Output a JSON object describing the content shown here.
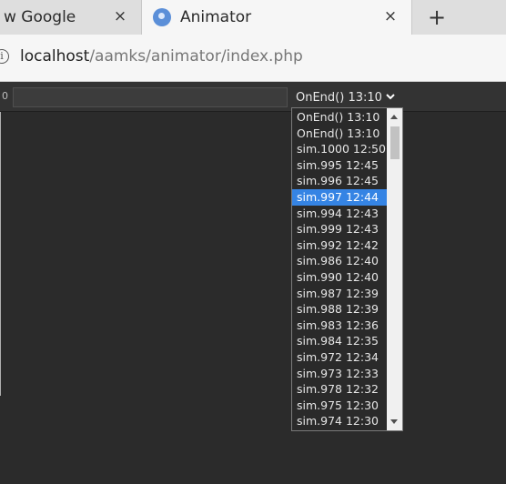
{
  "browser": {
    "tabs": [
      {
        "title": "w Google",
        "close": "×"
      },
      {
        "title": "Animator",
        "close": "×"
      }
    ],
    "new_tab": "+",
    "url_host": "localhost",
    "url_path": "/aamks/animator/index.php"
  },
  "toolbar": {
    "frame_label": "0",
    "text_input_value": "",
    "select_value": "OnEnd() 13:10"
  },
  "dropdown": {
    "selected_index": 5,
    "options": [
      "OnEnd() 13:10",
      "OnEnd() 13:10",
      "sim.1000 12:50",
      "sim.995 12:45",
      "sim.996 12:45",
      "sim.997 12:44",
      "sim.994 12:43",
      "sim.999 12:43",
      "sim.992 12:42",
      "sim.986 12:40",
      "sim.990 12:40",
      "sim.987 12:39",
      "sim.988 12:39",
      "sim.983 12:36",
      "sim.984 12:35",
      "sim.972 12:34",
      "sim.973 12:33",
      "sim.978 12:32",
      "sim.975 12:30",
      "sim.974 12:30"
    ]
  },
  "colors": {
    "accent": "#3584e4",
    "background": "#2b2b2b"
  }
}
